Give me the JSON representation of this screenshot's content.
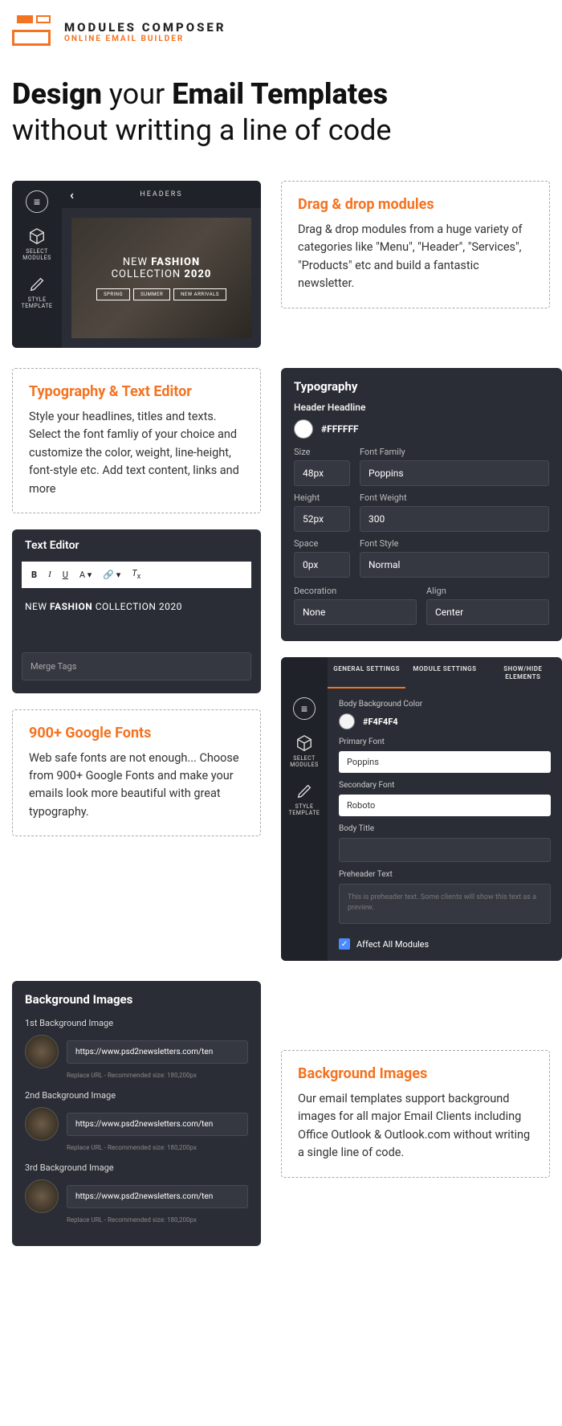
{
  "brand": {
    "title": "MODULES COMPOSER",
    "sub": "ONLINE EMAIL BUILDER"
  },
  "hero": {
    "p1a": "Design",
    "p1b": "your",
    "p1c": "Email Templates",
    "p2": "without writting a line of code"
  },
  "callouts": {
    "drag": {
      "title": "Drag & drop modules",
      "body": "Drag & drop modules from a huge variety of categories like \"Menu\", \"Header\", \"Services\", \"Products\" etc and build a fantastic newsletter."
    },
    "typo": {
      "title": "Typography & Text Editor",
      "body": "Style your headlines, titles and texts. Select the font famliy of your choice and customize the color, weight, line-height, font-style etc. Add text content, links and more"
    },
    "fonts": {
      "title": "900+ Google Fonts",
      "body": "Web safe fonts are not enough... Choose from 900+ Google Fonts and make your emails look more beautiful with great typography."
    },
    "bg": {
      "title": "Background Images",
      "body": "Our email templates support background images for all major Email Clients including Office Outlook & Outlook.com without writing a single line of code."
    }
  },
  "preview": {
    "headers": "HEADERS",
    "l1a": "NEW",
    "l1b": "FASHION",
    "l2a": "COLLECTION",
    "l2b": "2020",
    "btns": [
      "SPRING",
      "SUMMER",
      "NEW ARRIVALS"
    ],
    "side": {
      "select": "SELECT\nMODULES",
      "style": "STYLE\nTEMPLATE"
    }
  },
  "typography": {
    "title": "Typography",
    "sub": "Header Headline",
    "hex": "#FFFFFF",
    "fields": {
      "size": {
        "label": "Size",
        "value": "48px"
      },
      "family": {
        "label": "Font Family",
        "value": "Poppins"
      },
      "height": {
        "label": "Height",
        "value": "52px"
      },
      "weight": {
        "label": "Font Weight",
        "value": "300"
      },
      "space": {
        "label": "Space",
        "value": "0px"
      },
      "style": {
        "label": "Font Style",
        "value": "Normal"
      },
      "deco": {
        "label": "Decoration",
        "value": "None"
      },
      "align": {
        "label": "Align",
        "value": "Center"
      }
    }
  },
  "textEditor": {
    "title": "Text Editor",
    "content_a": "NEW",
    "content_b": "FASHION",
    "content_c": "COLLECTION 2020",
    "merge": "Merge Tags"
  },
  "settings": {
    "tabs": [
      "GENERAL SETTINGS",
      "MODULE SETTINGS",
      "SHOW/HIDE ELEMENTS"
    ],
    "bodyBg": {
      "label": "Body Background Color",
      "hex": "#F4F4F4"
    },
    "primary": {
      "label": "Primary Font",
      "value": "Poppins"
    },
    "secondary": {
      "label": "Secondary Font",
      "value": "Roboto"
    },
    "bodyTitle": "Body Title",
    "preheader": {
      "label": "Preheader Text",
      "placeholder": "This is preheader text. Some clients will show this text as a preview."
    },
    "affect": "Affect All Modules"
  },
  "bgImages": {
    "title": "Background Images",
    "items": [
      {
        "label": "1st Background Image",
        "url": "https://www.psd2newsletters.com/ten",
        "hint": "Replace URL - Recommended size: 180,200px"
      },
      {
        "label": "2nd Background Image",
        "url": "https://www.psd2newsletters.com/ten",
        "hint": "Replace URL - Recommended size: 180,200px"
      },
      {
        "label": "3rd Background Image",
        "url": "https://www.psd2newsletters.com/ten",
        "hint": "Replace URL - Recommended size: 180,200px"
      }
    ]
  }
}
